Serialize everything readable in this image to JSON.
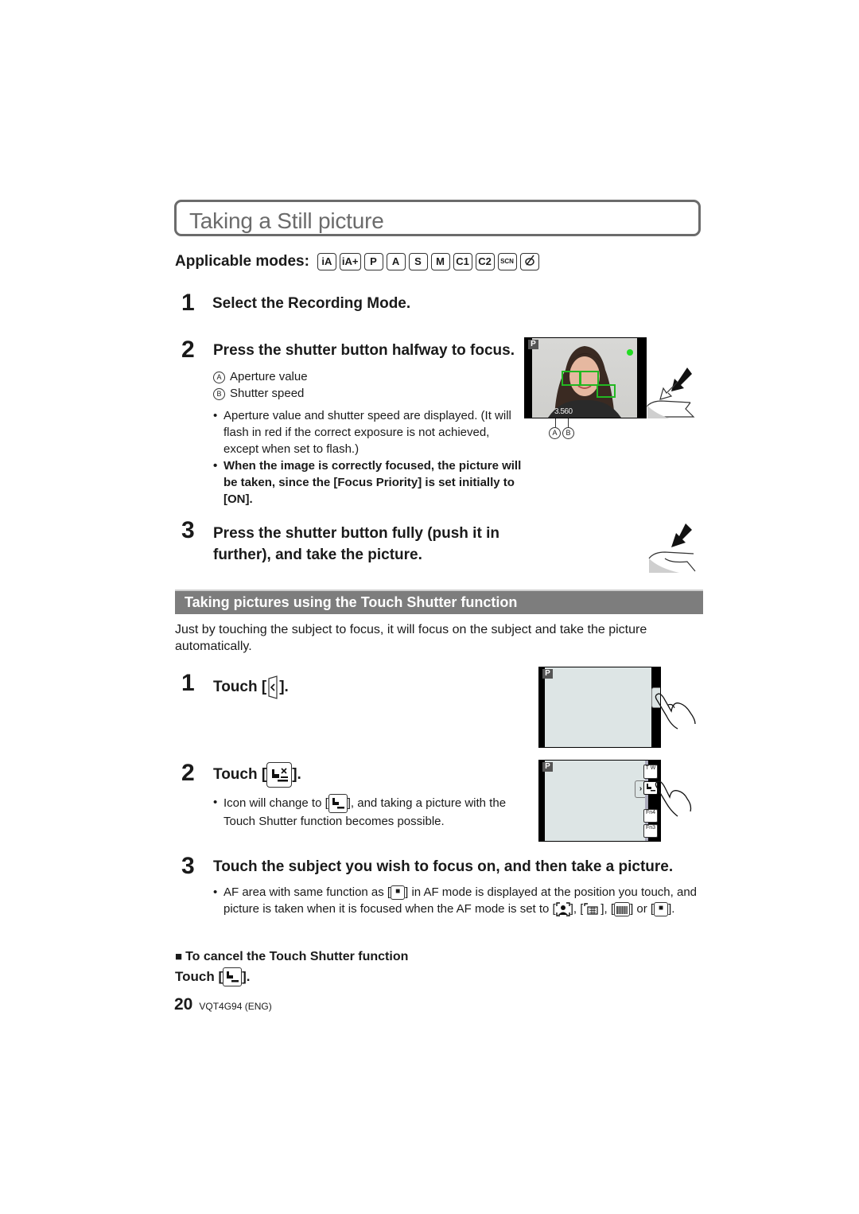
{
  "header": {
    "title": "Taking a Still picture"
  },
  "applicable_modes": {
    "label": "Applicable modes:",
    "modes": [
      "iA",
      "iA+",
      "P",
      "A",
      "S",
      "M",
      "C1",
      "C2",
      "SCN",
      "creative"
    ]
  },
  "basic_steps": [
    {
      "number": "1",
      "title": "Select the Recording Mode."
    },
    {
      "number": "2",
      "title": "Press the shutter button halfway to focus.",
      "legend": [
        {
          "marker": "A",
          "text": "Aperture value"
        },
        {
          "marker": "B",
          "text": "Shutter speed"
        }
      ],
      "notes": [
        {
          "text": "Aperture value and shutter speed are displayed. (It will flash in red if the correct exposure is not achieved, except when set to flash.)",
          "bold": false
        },
        {
          "text": "When the image is correctly focused, the picture will be taken, since the [Focus Priority] is set initially to [ON].",
          "bold": true
        }
      ]
    },
    {
      "number": "3",
      "title": "Press the shutter button fully (push it in further), and take the picture."
    }
  ],
  "illustration_focus": {
    "mode_badge": "P",
    "aperture": "3.5",
    "shutter": "60",
    "marker_a": "A",
    "marker_b": "B",
    "focus_color": "#22b822",
    "indicator_color": "#22dd22"
  },
  "touch_section": {
    "heading": "Taking pictures using the Touch Shutter function",
    "intro": "Just by touching the subject to focus, it will focus on the subject and take the picture automatically.",
    "steps": [
      {
        "number": "1",
        "prefix": "Touch [",
        "suffix": "].",
        "icon": "tab-arrow-icon"
      },
      {
        "number": "2",
        "prefix": "Touch [",
        "suffix": "].",
        "icon": "touch-shutter-off-icon",
        "note_prefix": "Icon will change to [",
        "note_suffix": "], and taking a picture with the Touch Shutter function becomes possible."
      },
      {
        "number": "3",
        "title": "Touch the subject you wish to focus on, and then take a picture.",
        "note_parts": [
          "AF area with same function as [",
          "] in AF mode is displayed at the position you touch, and picture is taken when it is focused when the AF mode is set to [",
          "], [",
          "], [",
          "] or [",
          "]."
        ]
      }
    ],
    "cancel": {
      "heading": "To cancel the Touch Shutter function",
      "prefix": "Touch [",
      "suffix": "]."
    },
    "screen_badge": "P",
    "side_buttons": [
      "T W",
      "Fn4",
      "Fn3"
    ]
  },
  "footer": {
    "page_number": "20",
    "code": "VQT4G94 (ENG)"
  }
}
